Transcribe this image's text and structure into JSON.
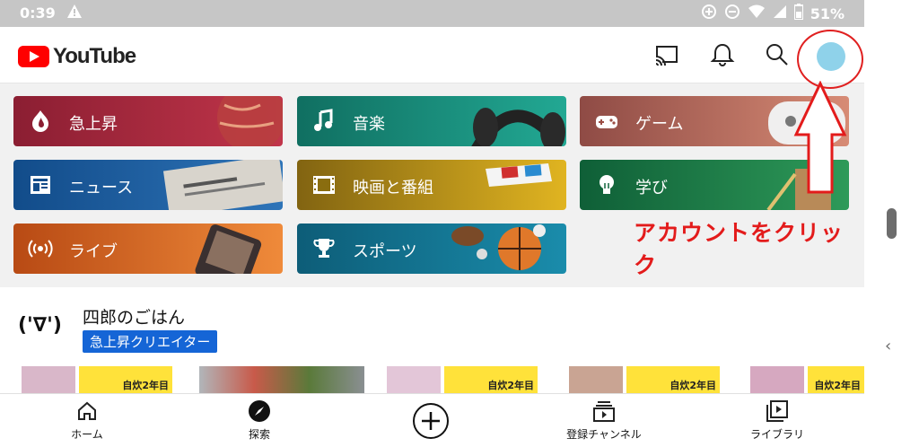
{
  "status_bar": {
    "time": "0:39",
    "battery": "51%"
  },
  "app": {
    "title": "YouTube"
  },
  "categories": [
    {
      "label": "急上昇",
      "icon": "flame-icon",
      "color": "#8b1e32"
    },
    {
      "label": "音楽",
      "icon": "music-note-icon",
      "color": "#13806f"
    },
    {
      "label": "ゲーム",
      "icon": "gamepad-icon",
      "color": "#9b4d44"
    },
    {
      "label": "ニュース",
      "icon": "newspaper-icon",
      "color": "#124c8a"
    },
    {
      "label": "映画と番組",
      "icon": "film-icon",
      "color": "#8a6d0f"
    },
    {
      "label": "学び",
      "icon": "lightbulb-icon",
      "color": "#10643a"
    },
    {
      "label": "ライブ",
      "icon": "live-icon",
      "color": "#b74a14"
    },
    {
      "label": "スポーツ",
      "icon": "trophy-icon",
      "color": "#0d5d78"
    }
  ],
  "annotation": {
    "text": "アカウントをクリック",
    "color": "#e31b1b"
  },
  "channel": {
    "avatar_text": "('∇')",
    "name": "四郎のごはん",
    "badge": "急上昇クリエイター"
  },
  "thumbnails": [
    {
      "label": "自炊2年目"
    },
    {
      "label": ""
    },
    {
      "label": "自炊2年目"
    },
    {
      "label": "自炊2年目"
    },
    {
      "label": "自炊2年目"
    }
  ],
  "bottom_nav": [
    {
      "label": "ホーム",
      "icon": "home-icon"
    },
    {
      "label": "探索",
      "icon": "explore-icon"
    },
    {
      "label": "",
      "icon": "create-plus-icon"
    },
    {
      "label": "登録チャンネル",
      "icon": "subscriptions-icon"
    },
    {
      "label": "ライブラリ",
      "icon": "library-icon"
    }
  ]
}
